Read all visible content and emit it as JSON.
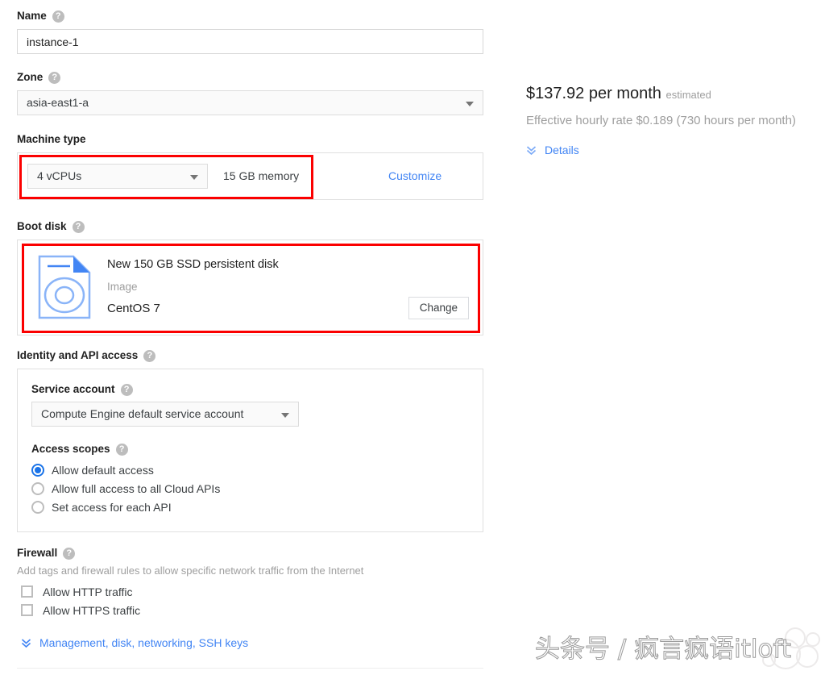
{
  "form": {
    "name": {
      "label": "Name",
      "help_icon": "help-icon",
      "value": "instance-1",
      "placeholder": "Name"
    },
    "zone": {
      "label": "Zone",
      "help_icon": "help-icon",
      "value": "asia-east1-a",
      "caret_icon": "chevron-down-icon"
    },
    "machine_type": {
      "label": "Machine type",
      "vcpus_value": "4 vCPUs",
      "memory_text": "15 GB memory",
      "customize_label": "Customize",
      "caret_icon": "chevron-down-icon",
      "highlight_color": "#fb0000"
    },
    "boot_disk": {
      "label": "Boot disk",
      "help_icon": "help-icon",
      "disk_icon": "disk-document-icon",
      "title": "New 150 GB SSD persistent disk",
      "image_label": "Image",
      "image_value": "CentOS 7",
      "change_label": "Change",
      "highlight_color": "#fb0000"
    },
    "identity": {
      "label": "Identity and API access",
      "help_icon": "help-icon",
      "service_account": {
        "label": "Service account",
        "help_icon": "help-icon",
        "value": "Compute Engine default service account",
        "caret_icon": "chevron-down-icon"
      },
      "access_scopes": {
        "label": "Access scopes",
        "help_icon": "help-icon",
        "options": [
          {
            "label": "Allow default access",
            "selected": true
          },
          {
            "label": "Allow full access to all Cloud APIs",
            "selected": false
          },
          {
            "label": "Set access for each API",
            "selected": false
          }
        ]
      }
    },
    "firewall": {
      "label": "Firewall",
      "help_icon": "help-icon",
      "description": "Add tags and firewall rules to allow specific network traffic from the Internet",
      "checkboxes": [
        {
          "label": "Allow HTTP traffic",
          "checked": false
        },
        {
          "label": "Allow HTTPS traffic",
          "checked": false
        }
      ]
    },
    "management_expander": {
      "label": "Management, disk, networking, SSH keys",
      "icon": "double-chevron-down-icon"
    }
  },
  "pricing": {
    "amount": "$137.92 per month",
    "estimated_suffix": "estimated",
    "effective_rate": "Effective hourly rate $0.189 (730 hours per month)",
    "details_label": "Details",
    "details_icon": "double-chevron-down-icon"
  },
  "watermark": {
    "text": "头条号 / 疯言疯语itloft"
  },
  "colors": {
    "accent_blue": "#4285f4",
    "radio_blue": "#1a73e8",
    "highlight_red": "#fb0000",
    "muted_grey": "#9e9e9e"
  }
}
